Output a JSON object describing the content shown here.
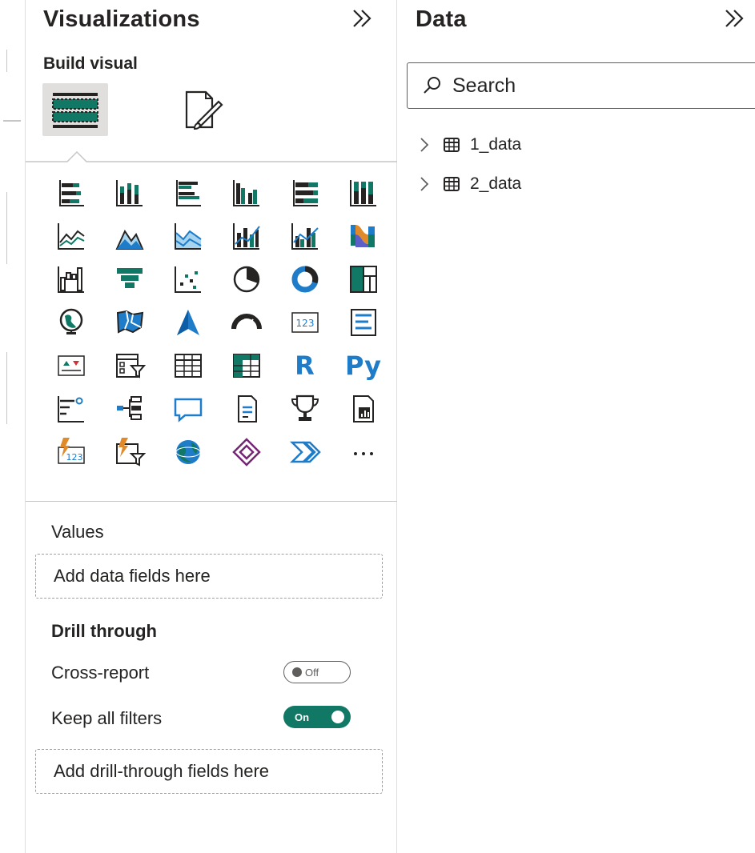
{
  "visualizations": {
    "title": "Visualizations",
    "build_label": "Build visual",
    "icons": [
      "stacked-bar-chart-icon",
      "stacked-column-chart-icon",
      "clustered-bar-chart-icon",
      "clustered-column-chart-icon",
      "100-percent-stacked-bar-icon",
      "100-percent-stacked-column-icon",
      "line-chart-icon",
      "area-chart-icon",
      "stacked-area-chart-icon",
      "line-and-stacked-column-icon",
      "line-and-clustered-column-icon",
      "ribbon-chart-icon",
      "waterfall-chart-icon",
      "funnel-chart-icon",
      "scatter-chart-icon",
      "pie-chart-icon",
      "donut-chart-icon",
      "treemap-icon",
      "map-icon",
      "filled-map-icon",
      "azure-map-icon",
      "gauge-icon",
      "card-icon",
      "multi-row-card-icon",
      "kpi-icon",
      "slicer-icon",
      "table-icon",
      "matrix-icon",
      "r-visual-icon",
      "python-visual-icon",
      "key-influencers-icon",
      "decomposition-tree-icon",
      "qa-icon",
      "smart-narrative-icon",
      "metrics-icon",
      "paginated-report-icon",
      "power-apps-card-icon",
      "power-apps-slicer-icon",
      "arcgis-map-icon",
      "power-apps-icon",
      "power-automate-icon",
      "more-visuals-icon"
    ],
    "r_label": "R",
    "py_label": "Py",
    "values_label": "Values",
    "values_placeholder": "Add data fields here",
    "drill_through_label": "Drill through",
    "cross_report_label": "Cross-report",
    "cross_report_state": "Off",
    "keep_filters_label": "Keep all filters",
    "keep_filters_state": "On",
    "drill_placeholder": "Add drill-through fields here"
  },
  "data": {
    "title": "Data",
    "search_placeholder": "Search",
    "tables": [
      {
        "name": "1_data"
      },
      {
        "name": "2_data"
      }
    ]
  },
  "colors": {
    "accent_teal": "#117865",
    "blue": "#1e7cc9",
    "text": "#252423"
  }
}
